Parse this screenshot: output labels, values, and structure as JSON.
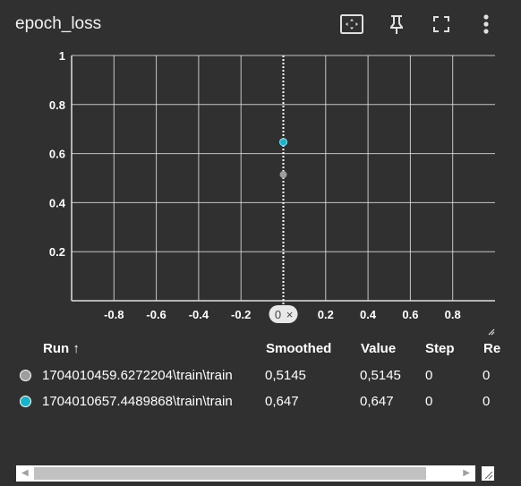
{
  "card": {
    "title": "epoch_loss"
  },
  "toolbar": {
    "buttons": [
      {
        "name": "fit-domain-icon"
      },
      {
        "name": "pin-icon"
      },
      {
        "name": "fullscreen-icon"
      },
      {
        "name": "more-vert-icon"
      }
    ]
  },
  "chart_data": {
    "type": "scatter",
    "xlim": [
      -1,
      1
    ],
    "ylim": [
      0,
      1
    ],
    "x_ticks": [
      "-0.8",
      "-0.6",
      "-0.4",
      "-0.2",
      "0",
      "0.2",
      "0.4",
      "0.6",
      "0.8"
    ],
    "y_ticks": [
      "0.2",
      "0.4",
      "0.6",
      "0.8",
      "1"
    ],
    "grid": true,
    "hover_x": 0,
    "hover_x_label": "0",
    "series": [
      {
        "color": "#9e9e9e",
        "points": [
          {
            "x": 0,
            "y": 0.5145
          }
        ]
      },
      {
        "color": "#12b5cb",
        "points": [
          {
            "x": 0,
            "y": 0.647
          }
        ]
      }
    ]
  },
  "table": {
    "headers": {
      "run": "Run",
      "sort_arrow": "↑",
      "smoothed": "Smoothed",
      "value": "Value",
      "step": "Step",
      "relative": "Re"
    },
    "rows": [
      {
        "run": "1704010459.6272204\\train\\train",
        "smoothed": "0,5145",
        "value": "0,5145",
        "step": "0",
        "relative": "0",
        "color": "#9e9e9e"
      },
      {
        "run": "1704010657.4489868\\train\\train",
        "smoothed": "0,647",
        "value": "0,647",
        "step": "0",
        "relative": "0",
        "color": "#12b5cb"
      }
    ]
  },
  "colors": {
    "background": "#303030",
    "grid": "#e0e0e0",
    "hover_line": "#ffffff"
  }
}
